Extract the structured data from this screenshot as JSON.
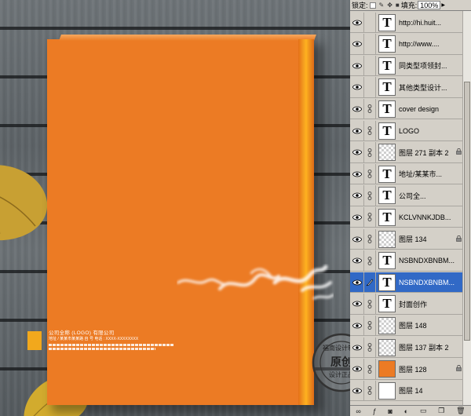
{
  "options_bar": {
    "lock_label": "锁定:",
    "fill_label": "填充:",
    "fill_value": "100%"
  },
  "layers": [
    {
      "name": "http://hi.huit...",
      "kind": "text"
    },
    {
      "name": "http://www....",
      "kind": "text"
    },
    {
      "name": "同类型项领封...",
      "kind": "text"
    },
    {
      "name": "其他类型设计...",
      "kind": "text"
    },
    {
      "name": "cover design",
      "kind": "text"
    },
    {
      "name": "LOGO",
      "kind": "text"
    },
    {
      "name": "图层 271 副本 2",
      "kind": "checker",
      "locked": true
    },
    {
      "name": "地址/某某市...",
      "kind": "text"
    },
    {
      "name": "公司全...",
      "kind": "text"
    },
    {
      "name": "KCLVNNKJDB...",
      "kind": "text"
    },
    {
      "name": "图层 134",
      "kind": "checker",
      "locked": true
    },
    {
      "name": "NSBNDXBNBM...",
      "kind": "text"
    },
    {
      "name": "NSBNDXBNBM...",
      "kind": "text",
      "selected": true
    },
    {
      "name": "封面创作",
      "kind": "text"
    },
    {
      "name": "图层 148",
      "kind": "checker"
    },
    {
      "name": "图层 137 副本 2",
      "kind": "checker"
    },
    {
      "name": "图层 128",
      "kind": "orange",
      "locked": true
    },
    {
      "name": "图层 14",
      "kind": "white"
    }
  ],
  "book": {
    "company": "公司全称 (LOGO) 有限公司",
    "address": "地址 / 某某市某某路 自 号   电话 : XXXX-XXXXXXXX",
    "fine_print": "KCLVNNKJDB NSBNDXBNBM XCGHJSKHJD"
  },
  "stamp": {
    "top_text": "福南设计制作",
    "center_text": "原创",
    "sub_text": "设计正品"
  },
  "colors": {
    "cover_orange": "#ec7b24",
    "selection_blue": "#3169c6",
    "panel_gray": "#d4d0c8"
  }
}
